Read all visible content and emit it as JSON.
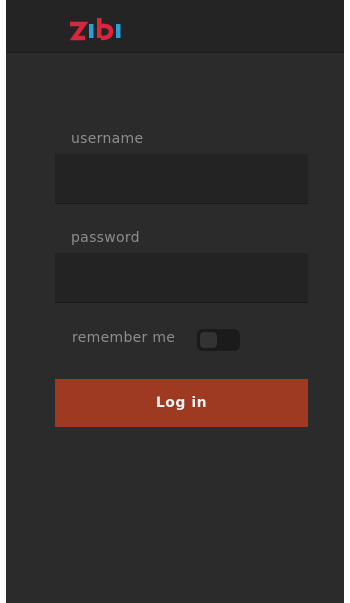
{
  "header": {
    "logo_text": "zibi",
    "logo_colors": {
      "primary": "#d7263d",
      "secondary": "#2a9fd6"
    }
  },
  "form": {
    "username": {
      "label": "username",
      "value": "",
      "placeholder": ""
    },
    "password": {
      "label": "password",
      "value": "",
      "placeholder": ""
    },
    "remember": {
      "label": "remember me",
      "checked": false
    },
    "submit_label": "Log in"
  },
  "colors": {
    "background": "#2b2b2b",
    "header": "#242424",
    "input": "#232323",
    "button": "#9e3a22",
    "label": "#8d8d8d"
  }
}
